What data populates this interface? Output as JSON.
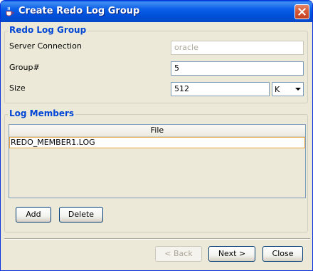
{
  "window": {
    "title": "Create Redo Log Group",
    "app_icon": "java-cup-icon",
    "close_icon": "close-icon"
  },
  "redo_log_group": {
    "legend": "Redo Log Group",
    "server_connection_label": "Server Connection",
    "server_connection_value": "oracle",
    "group_label": "Group#",
    "group_value": "5",
    "size_label": "Size",
    "size_value": "512",
    "size_unit": "K"
  },
  "log_members": {
    "legend": "Log Members",
    "columns": [
      "File"
    ],
    "rows": [
      "REDO_MEMBER1.LOG"
    ],
    "add_label": "Add",
    "delete_label": "Delete"
  },
  "footer": {
    "back_label": "< Back",
    "next_label": "Next >",
    "close_label": "Close"
  },
  "colors": {
    "title_bar": "#0a5ee8",
    "legend_text": "#0046d5",
    "window_bg": "#ece9d8",
    "selection_border": "#e8a33b"
  }
}
